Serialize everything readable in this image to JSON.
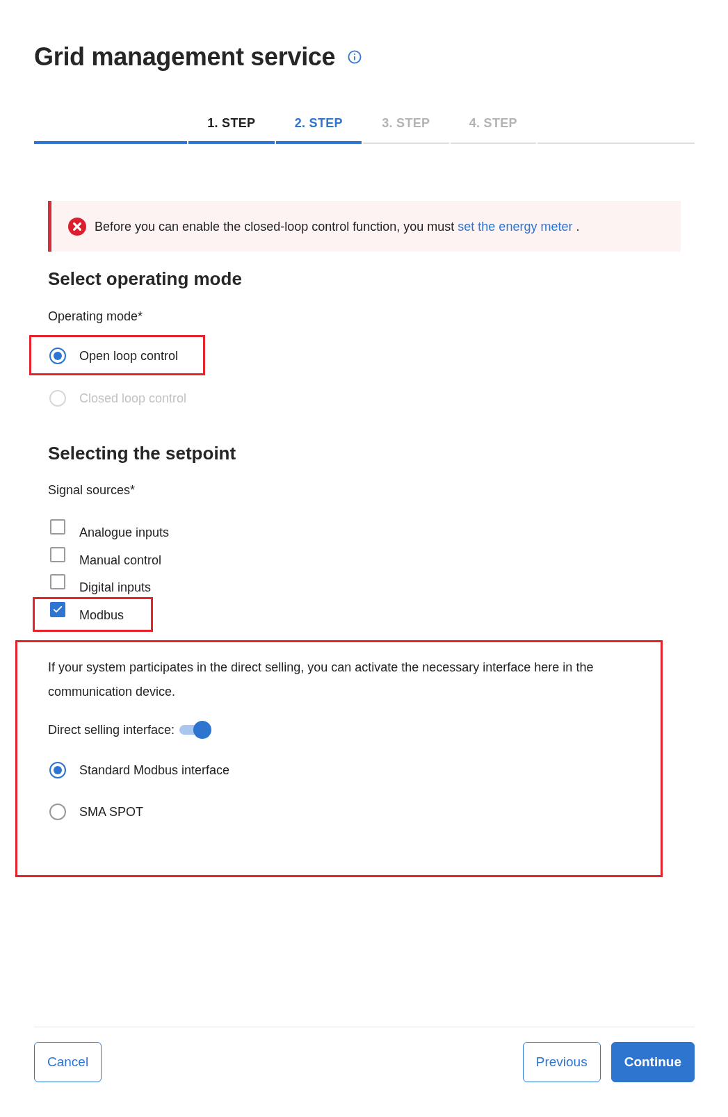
{
  "page": {
    "title": "Grid management service"
  },
  "steps": [
    {
      "label": "1. STEP",
      "completed": true,
      "selected": false
    },
    {
      "label": "2. STEP",
      "completed": false,
      "selected": true
    },
    {
      "label": "3. STEP",
      "completed": false,
      "selected": false
    },
    {
      "label": "4. STEP",
      "completed": false,
      "selected": false
    }
  ],
  "alert": {
    "kind": "error",
    "message": "Before you can enable the closed-loop control function, you must",
    "link": "set the energy meter",
    "message_end": "."
  },
  "operating_mode": {
    "heading": "Select operating mode",
    "label": "Operating mode*",
    "options": [
      {
        "label": "Open loop control",
        "selected": true,
        "disabled": false,
        "highlighted": true
      },
      {
        "label": "Closed loop control",
        "selected": false,
        "disabled": true,
        "highlighted": false
      }
    ]
  },
  "setpoint": {
    "heading": "Selecting the setpoint",
    "label": "Signal sources*",
    "options": [
      {
        "label": "Analogue inputs",
        "checked": false,
        "highlighted": false
      },
      {
        "label": "Manual control",
        "checked": false,
        "highlighted": false
      },
      {
        "label": "Digital inputs",
        "checked": false,
        "highlighted": false
      },
      {
        "label": "Modbus",
        "checked": true,
        "highlighted": true
      }
    ]
  },
  "direct_selling": {
    "highlighted": true,
    "description": "If your system participates in the direct selling, you can activate the necessary interface here in the communication device.",
    "toggle_label": "Direct selling interface:",
    "on": true,
    "options": [
      {
        "label": "Standard Modbus interface",
        "selected": true
      },
      {
        "label": "SMA SPOT",
        "selected": false
      }
    ]
  },
  "footer": {
    "buttons_start": [
      {
        "label": "Cancel",
        "kind": "secondary"
      }
    ],
    "buttons_end": [
      {
        "label": "Previous",
        "kind": "secondary"
      },
      {
        "label": "Continue",
        "kind": "primary"
      }
    ]
  }
}
